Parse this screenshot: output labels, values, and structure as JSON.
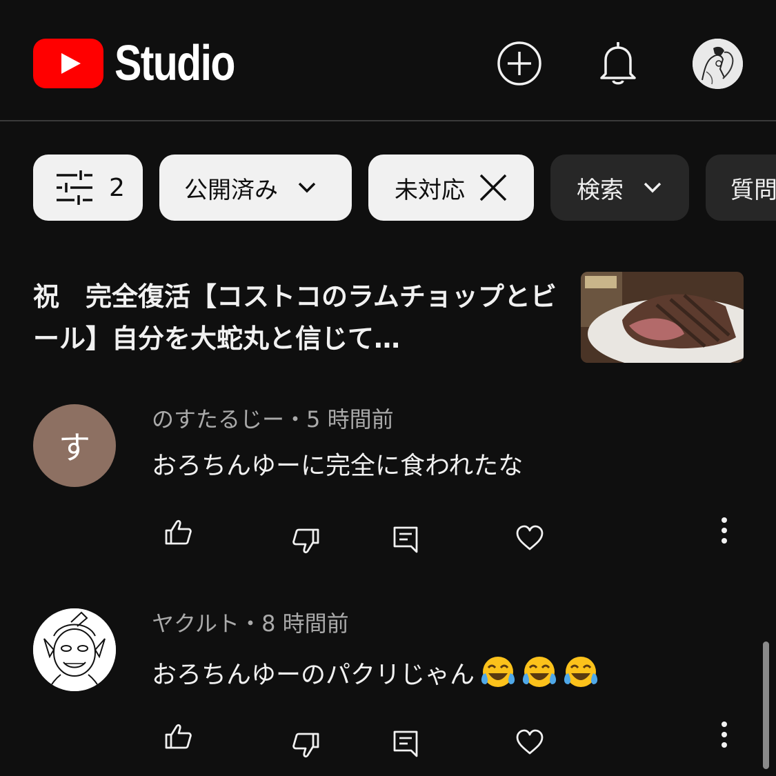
{
  "header": {
    "logo_text": "Studio",
    "icons": [
      "youtube-logo-icon",
      "create-plus-icon",
      "bell-icon",
      "account-avatar"
    ]
  },
  "filters": {
    "filter_count": "2",
    "published_label": "公開済み",
    "unanswered_label": "未対応",
    "search_label": "検索",
    "questions_label": "質問"
  },
  "video": {
    "title": "祝　完全復活【コストコのラムチョップとビール】自分を大蛇丸と信じて…"
  },
  "comments": [
    {
      "avatar_letter": "す",
      "avatar_color": "#8d7062",
      "author": "のすたるじー",
      "separator": "・",
      "time": "5 時間前",
      "text": "おろちんゆーに完全に食われたな"
    },
    {
      "avatar_letter": "",
      "author": "ヤクルト",
      "separator": "・",
      "time": "8 時間前",
      "text": "おろちんゆーのパクリじゃん",
      "emoji_count": 3,
      "emoji": "face-with-tears-of-joy"
    }
  ],
  "colors": {
    "background": "#0f0f0f",
    "brand_red": "#ff0000",
    "chip_light": "#f1f1f1",
    "chip_dark": "#272727",
    "meta_gray": "#aaaaaa"
  }
}
